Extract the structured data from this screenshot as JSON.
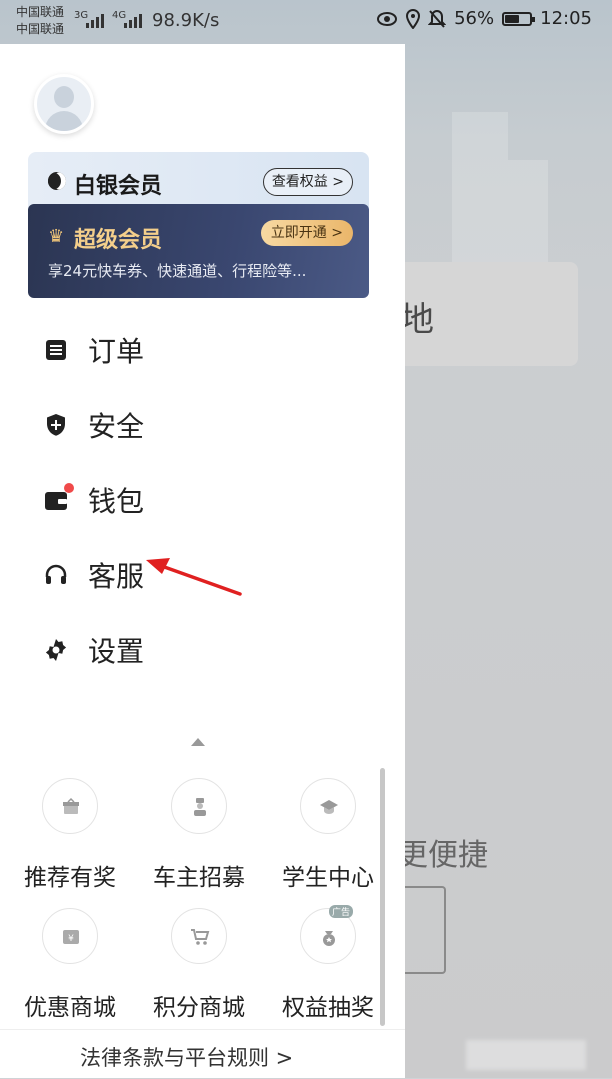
{
  "status_bar": {
    "carrier_1": "中国联通",
    "carrier_2": "中国联通",
    "net_1": "3G",
    "net_2": "4G",
    "speed": "98.9K/s",
    "battery": "56%",
    "time": "12:05",
    "icons": [
      "eye-icon",
      "location-icon",
      "bell-off-icon",
      "battery-icon"
    ]
  },
  "background_app": {
    "card_text": "地",
    "bottom_text": "更便捷"
  },
  "drawer": {
    "silver_member": {
      "title": "白银会员",
      "button": "查看权益 >"
    },
    "super_member": {
      "title": "超级会员",
      "button": "立即开通 >",
      "description": "享24元快车券、快速通道、行程险等..."
    },
    "menu": [
      {
        "label": "订单",
        "icon": "order-icon"
      },
      {
        "label": "安全",
        "icon": "shield-icon"
      },
      {
        "label": "钱包",
        "icon": "wallet-icon",
        "badge": true
      },
      {
        "label": "客服",
        "icon": "headset-icon"
      },
      {
        "label": "设置",
        "icon": "gear-icon"
      }
    ],
    "grid": [
      {
        "label": "推荐有奖",
        "icon": "gift-icon"
      },
      {
        "label": "车主招募",
        "icon": "driver-icon"
      },
      {
        "label": "学生中心",
        "icon": "graduation-cap-icon"
      },
      {
        "label": "优惠商城",
        "icon": "coupon-icon"
      },
      {
        "label": "积分商城",
        "icon": "cart-icon"
      },
      {
        "label": "权益抽奖",
        "icon": "lottery-icon",
        "tag": "广告"
      }
    ],
    "footer": "法律条款与平台规则 >"
  },
  "colors": {
    "super_member_bg": "#2f3a5c",
    "gold": "#f4cf8b",
    "badge_red": "#f04a4a",
    "annotation_arrow": "#e02020"
  }
}
